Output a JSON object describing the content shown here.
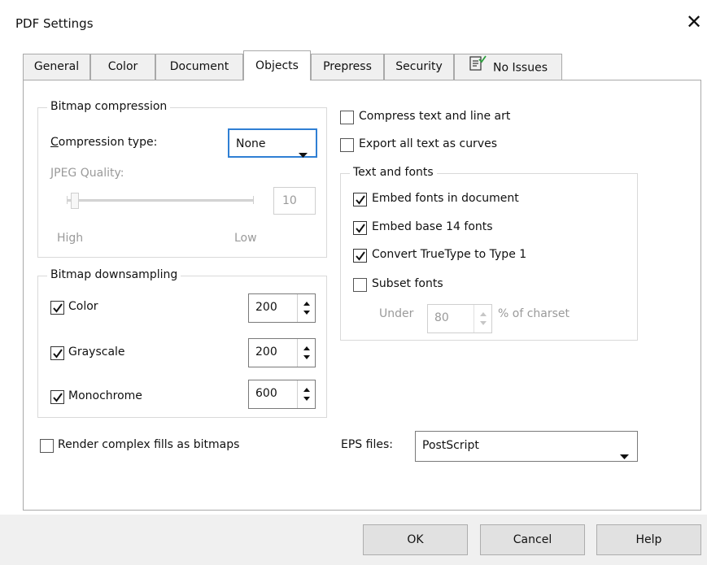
{
  "window": {
    "title": "PDF Settings"
  },
  "tabs": [
    {
      "label": "General"
    },
    {
      "label": "Color"
    },
    {
      "label": "Document"
    },
    {
      "label": "Objects"
    },
    {
      "label": "Prepress"
    },
    {
      "label": "Security"
    },
    {
      "label": "No Issues"
    }
  ],
  "active_tab": "Objects",
  "bitmap_compression": {
    "title": "Bitmap compression",
    "compression_type_label": "Compression type:",
    "compression_type_value": "None",
    "jpeg_quality_label": "JPEG Quality:",
    "jpeg_quality_value": "10",
    "high_label": "High",
    "low_label": "Low"
  },
  "bitmap_downsampling": {
    "title": "Bitmap downsampling",
    "color": {
      "label": "Color",
      "checked": true,
      "value": "200"
    },
    "grayscale": {
      "label": "Grayscale",
      "checked": true,
      "value": "200"
    },
    "monochrome": {
      "label": "Monochrome",
      "checked": true,
      "value": "600"
    }
  },
  "render_complex_fills": {
    "label": "Render complex fills as bitmaps",
    "checked": false
  },
  "compress_text": {
    "label": "Compress text and line art",
    "checked": false
  },
  "export_text_curves": {
    "label": "Export all text as curves",
    "checked": false
  },
  "text_and_fonts": {
    "title": "Text and fonts",
    "embed_fonts": {
      "label": "Embed fonts in document",
      "checked": true
    },
    "embed_base14": {
      "label": "Embed base 14 fonts",
      "checked": true
    },
    "convert_truetype": {
      "label": "Convert TrueType to Type 1",
      "checked": true
    },
    "subset_fonts": {
      "label": "Subset fonts",
      "checked": false
    },
    "under_label": "Under",
    "under_value": "80",
    "charset_label": "% of charset"
  },
  "eps_files": {
    "label": "EPS files:",
    "value": "PostScript"
  },
  "buttons": {
    "ok": "OK",
    "cancel": "Cancel",
    "help": "Help"
  }
}
